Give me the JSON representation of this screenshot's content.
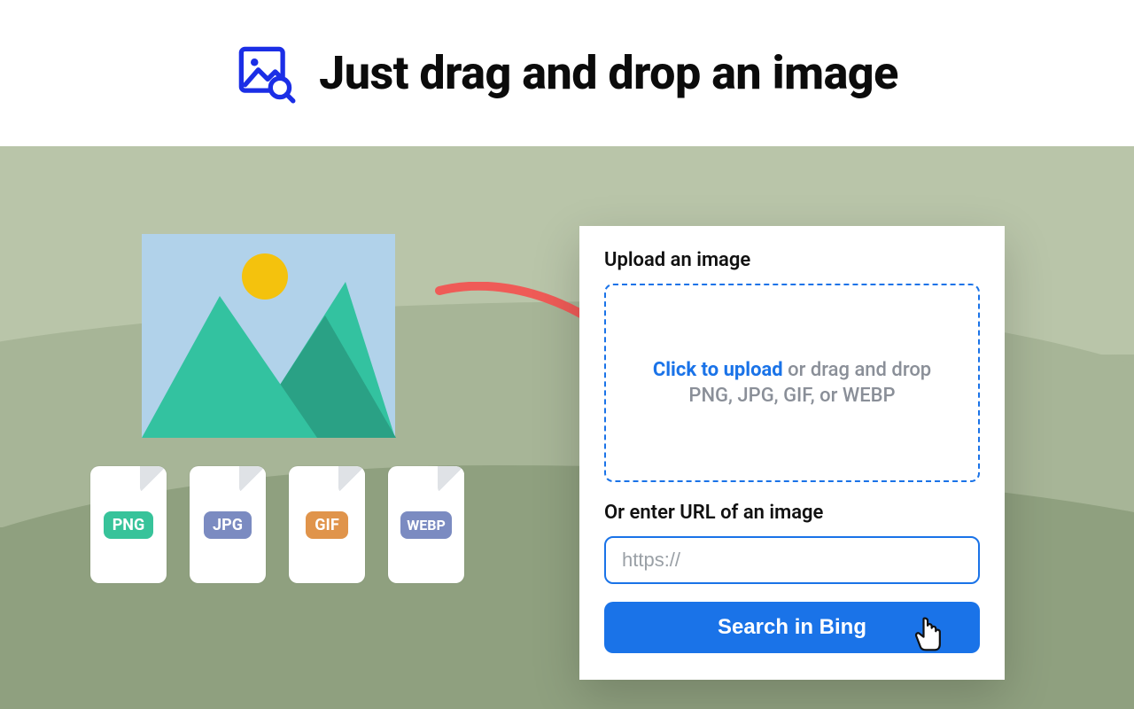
{
  "header": {
    "title": "Just drag and drop an image"
  },
  "files": {
    "png": "PNG",
    "jpg": "JPG",
    "gif": "GIF",
    "webp": "WEBP"
  },
  "panel": {
    "upload_label": "Upload an image",
    "click_to_upload": "Click to upload",
    "drag_suffix": " or drag and drop",
    "formats": "PNG, JPG, GIF, or WEBP",
    "url_label": "Or enter URL of an image",
    "url_placeholder": "https://",
    "search_button": "Search in Bing"
  },
  "colors": {
    "accent": "#1a73e8"
  }
}
